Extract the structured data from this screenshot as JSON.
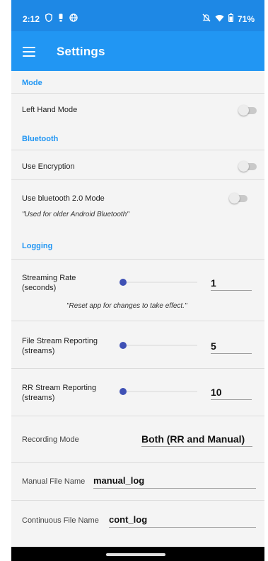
{
  "status_bar": {
    "time": "2:12",
    "left_icons": [
      "shield-icon",
      "notification-icon",
      "globe-icon"
    ],
    "right_icons": [
      "mute-icon",
      "wifi-icon",
      "battery-icon"
    ],
    "battery": "71%"
  },
  "app_bar": {
    "title": "Settings",
    "menu_icon": "hamburger-menu-icon"
  },
  "sections": {
    "mode": {
      "header": "Mode",
      "left_hand_mode": {
        "label": "Left Hand Mode",
        "enabled": false
      }
    },
    "bluetooth": {
      "header": "Bluetooth",
      "use_encryption": {
        "label": "Use Encryption",
        "enabled": false
      },
      "bt20_mode": {
        "label": "Use bluetooth 2.0 Mode",
        "note": "\"Used for older Android Bluetooth\"",
        "enabled": false
      }
    },
    "logging": {
      "header": "Logging",
      "streaming_rate": {
        "label_line1": "Streaming Rate",
        "label_line2": "(seconds)",
        "value": "1",
        "slider_position": 0.0,
        "note": "\"Reset app for changes to take effect.\""
      },
      "file_stream": {
        "label_line1": "File Stream Reporting",
        "label_line2": "(streams)",
        "value": "5",
        "slider_position": 0.0
      },
      "rr_stream": {
        "label_line1": "RR Stream Reporting",
        "label_line2": "(streams)",
        "value": "10",
        "slider_position": 0.0
      },
      "recording_mode": {
        "label": "Recording Mode",
        "value": "Both (RR and Manual)"
      },
      "manual_file_name": {
        "label": "Manual File Name",
        "value": "manual_log"
      },
      "continuous_file_name": {
        "label": "Continuous File Name",
        "value": "cont_log"
      }
    }
  },
  "colors": {
    "status_bar": "#1e88e5",
    "app_bar": "#2196f3",
    "section_header": "#2196f3",
    "slider_knob": "#3f51b5",
    "background": "#f4f4f4"
  }
}
